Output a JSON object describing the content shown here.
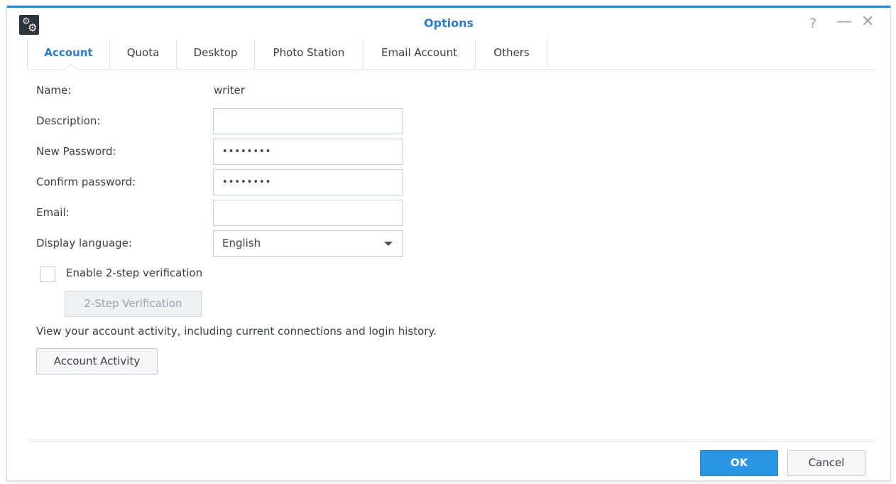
{
  "window": {
    "title": "Options",
    "accent": "#2b7bce"
  },
  "tabs": [
    {
      "label": "Account"
    },
    {
      "label": "Quota"
    },
    {
      "label": "Desktop"
    },
    {
      "label": "Photo Station"
    },
    {
      "label": "Email Account"
    },
    {
      "label": "Others"
    }
  ],
  "form": {
    "name_label": "Name:",
    "name_value": "writer",
    "description_label": "Description:",
    "description_value": "",
    "new_password_label": "New Password:",
    "new_password_value": "••••••••",
    "confirm_password_label": "Confirm password:",
    "confirm_password_value": "••••••••",
    "email_label": "Email:",
    "email_value": "",
    "language_label": "Display language:",
    "language_value": "English",
    "two_step_checkbox_label": "Enable 2-step verification",
    "two_step_checked": false,
    "two_step_button": "2-Step Verification",
    "activity_text": "View your account activity, including current connections and login history.",
    "activity_button": "Account Activity"
  },
  "footer": {
    "ok_label": "OK",
    "cancel_label": "Cancel"
  },
  "icons": {
    "app": "settings-gears-icon",
    "help": "help-icon",
    "minimize": "minimize-icon",
    "close": "close-icon",
    "dropdown": "chevron-down-icon"
  }
}
